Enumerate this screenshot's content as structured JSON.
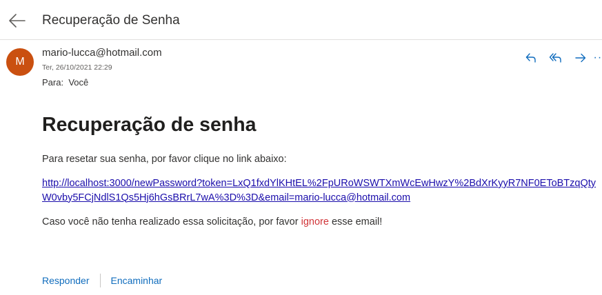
{
  "email": {
    "subject": "Recuperação de Senha",
    "sender": "mario-lucca@hotmail.com",
    "avatar_initial": "M",
    "date": "Ter, 26/10/2021 22:29",
    "to_label": "Para:",
    "to_value": "Você"
  },
  "body": {
    "heading": "Recuperação de senha",
    "intro": "Para resetar sua senha, por favor clique no link abaixo:",
    "link": "http://localhost:3000/newPassword?token=LxQ1fxdYlKHtEL%2FpURoWSWTXmWcEwHwzY%2BdXrKyyR7NF0EToBTzqQtyW0vby5FCjNdlS1Qs5Hj6hGsBRrL7wA%3D%3D&email=mario-lucca@hotmail.com",
    "closing_before": "Caso você não tenha realizado essa solicitação, por favor ",
    "closing_highlight": "ignore",
    "closing_after": " esse email!"
  },
  "footer": {
    "reply_label": "Responder",
    "forward_label": "Encaminhar"
  },
  "icons": {
    "back": "arrow-left-icon",
    "reply": "reply-icon",
    "reply_all": "reply-all-icon",
    "forward": "forward-icon",
    "more": "more-icon"
  },
  "colors": {
    "accent": "#0f6cbd",
    "avatar_bg": "#ca5010",
    "link": "#1a0dab",
    "highlight": "#d13438"
  }
}
